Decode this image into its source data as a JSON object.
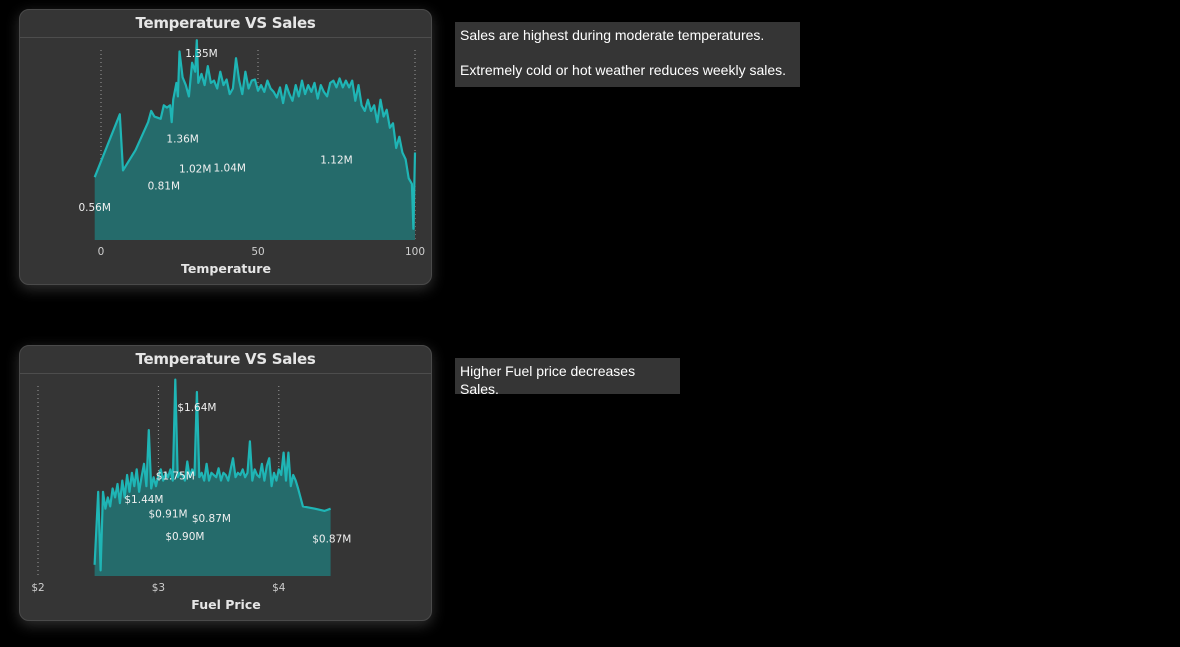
{
  "charts": [
    {
      "title": "Temperature VS Sales",
      "xlabel": "Temperature",
      "x_ticks": [
        "0",
        "50",
        "100"
      ],
      "data_labels": [
        "1.35M",
        "1.36M",
        "1.02M",
        "1.04M",
        "0.81M",
        "0.56M",
        "1.12M"
      ]
    },
    {
      "title": "Temperature VS Sales",
      "xlabel": "Fuel Price",
      "x_ticks": [
        "$2",
        "$3",
        "$4"
      ],
      "data_labels": [
        "$1.64M",
        "$1.75M",
        "$1.44M",
        "$0.91M",
        "$0.87M",
        "$0.90M",
        "$0.87M"
      ]
    }
  ],
  "notes": {
    "note1": [
      "Sales are highest during moderate temperatures.",
      "Extremely cold or hot weather reduces weekly sales."
    ],
    "note2": [
      "Higher Fuel price decreases Sales."
    ]
  },
  "colors": {
    "line": "#1fb5b5",
    "area": "#256b6b",
    "background": "#000000",
    "card": "#353535"
  },
  "chart_data": [
    {
      "type": "area",
      "title": "Temperature VS Sales",
      "xlabel": "Temperature",
      "ylabel": "",
      "xlim": [
        0,
        100
      ],
      "ylim": [
        0,
        1.8
      ],
      "grid": "vertical dotted at x ticks",
      "x_ticks": [
        0,
        50,
        100
      ],
      "x": [
        -2,
        6,
        7,
        11,
        15,
        16,
        17,
        19,
        20,
        21,
        22,
        22.5,
        23,
        24,
        24.5,
        25,
        26,
        27,
        28,
        29,
        30,
        30.5,
        31,
        32,
        33,
        34,
        35,
        36,
        37,
        38,
        39,
        40,
        41,
        42,
        43,
        44,
        45,
        46,
        47,
        48,
        49,
        50,
        51,
        52,
        53,
        54,
        55,
        56,
        57,
        58,
        59,
        60,
        61,
        62,
        63,
        64,
        65,
        66,
        67,
        68,
        69,
        70,
        71,
        72,
        73,
        74,
        75,
        76,
        77,
        78,
        79,
        80,
        81,
        82,
        83,
        84,
        85,
        86,
        87,
        88,
        89,
        90,
        91,
        92,
        93,
        94,
        95,
        96,
        97,
        98,
        99,
        99.5,
        100
      ],
      "series": [
        {
          "name": "",
          "values": [
            0.56,
            1.12,
            0.62,
            0.8,
            1.05,
            1.15,
            1.1,
            1.08,
            1.2,
            1.18,
            1.2,
            1.05,
            1.25,
            1.4,
            1.28,
            1.68,
            1.45,
            1.38,
            1.28,
            1.58,
            1.5,
            1.78,
            1.4,
            1.48,
            1.38,
            1.55,
            1.4,
            1.42,
            1.35,
            1.5,
            1.38,
            1.43,
            1.3,
            1.35,
            1.62,
            1.42,
            1.3,
            1.5,
            1.35,
            1.42,
            1.43,
            1.33,
            1.38,
            1.32,
            1.42,
            1.35,
            1.32,
            1.27,
            1.36,
            1.22,
            1.38,
            1.3,
            1.24,
            1.38,
            1.28,
            1.42,
            1.3,
            1.38,
            1.32,
            1.4,
            1.26,
            1.38,
            1.32,
            1.28,
            1.4,
            1.42,
            1.36,
            1.44,
            1.36,
            1.42,
            1.36,
            1.42,
            1.24,
            1.38,
            1.2,
            1.15,
            1.25,
            1.15,
            1.2,
            1.05,
            1.25,
            1.1,
            1.16,
            1.0,
            1.04,
            0.82,
            0.92,
            0.78,
            0.72,
            0.55,
            0.5,
            0.1,
            0.78,
            0.1
          ]
        }
      ],
      "annotations": [
        {
          "text": "1.35M",
          "x": 32,
          "y": 1.63
        },
        {
          "text": "1.36M",
          "x": 26,
          "y": 0.87
        },
        {
          "text": "1.02M",
          "x": 30,
          "y": 0.6
        },
        {
          "text": "1.04M",
          "x": 41,
          "y": 0.61
        },
        {
          "text": "0.81M",
          "x": 20,
          "y": 0.45
        },
        {
          "text": "0.56M",
          "x": -2,
          "y": 0.26
        },
        {
          "text": "1.12M",
          "x": 75,
          "y": 0.68
        }
      ]
    },
    {
      "type": "area",
      "title": "Temperature VS Sales",
      "xlabel": "Fuel Price",
      "ylabel": "",
      "xlim": [
        2,
        4.5
      ],
      "ylim": [
        0,
        1.8
      ],
      "grid": "vertical dotted at x ticks",
      "x_ticks": [
        2,
        3,
        4
      ],
      "x_tick_labels": [
        "$2",
        "$3",
        "$4"
      ],
      "x": [
        2.47,
        2.5,
        2.52,
        2.54,
        2.56,
        2.58,
        2.6,
        2.62,
        2.64,
        2.66,
        2.68,
        2.7,
        2.72,
        2.74,
        2.76,
        2.78,
        2.8,
        2.82,
        2.84,
        2.86,
        2.88,
        2.9,
        2.92,
        2.94,
        2.96,
        2.98,
        3.0,
        3.02,
        3.04,
        3.06,
        3.08,
        3.1,
        3.12,
        3.14,
        3.16,
        3.18,
        3.2,
        3.22,
        3.24,
        3.26,
        3.28,
        3.3,
        3.32,
        3.34,
        3.36,
        3.38,
        3.4,
        3.42,
        3.44,
        3.46,
        3.48,
        3.5,
        3.52,
        3.54,
        3.56,
        3.58,
        3.6,
        3.62,
        3.64,
        3.66,
        3.68,
        3.7,
        3.72,
        3.74,
        3.76,
        3.78,
        3.8,
        3.82,
        3.84,
        3.86,
        3.88,
        3.9,
        3.92,
        3.94,
        3.96,
        3.98,
        4.0,
        4.02,
        4.04,
        4.06,
        4.08,
        4.1,
        4.12,
        4.14,
        4.16,
        4.2,
        4.3,
        4.38,
        4.43
      ],
      "series": [
        {
          "name": "",
          "values": [
            0.1,
            0.75,
            0.05,
            0.75,
            0.6,
            0.7,
            0.62,
            0.78,
            0.7,
            0.82,
            0.65,
            0.85,
            0.7,
            0.9,
            0.75,
            0.92,
            0.8,
            0.95,
            0.75,
            0.88,
            1.0,
            0.8,
            1.3,
            0.78,
            0.88,
            0.8,
            0.9,
            0.95,
            0.85,
            0.92,
            0.88,
            0.95,
            0.85,
            1.75,
            0.88,
            0.92,
            0.9,
            0.85,
            1.02,
            0.88,
            0.95,
            0.9,
            1.64,
            0.88,
            0.92,
            0.85,
            1.0,
            0.85,
            0.92,
            0.9,
            0.88,
            0.96,
            0.85,
            0.92,
            0.9,
            0.85,
            0.95,
            1.05,
            0.88,
            0.92,
            0.9,
            0.95,
            0.88,
            0.92,
            1.2,
            0.85,
            0.95,
            0.9,
            0.88,
            1.0,
            0.85,
            0.98,
            1.05,
            0.8,
            0.92,
            0.85,
            0.95,
            0.9,
            1.1,
            0.85,
            1.1,
            0.8,
            0.9,
            0.85,
            0.78,
            0.62,
            0.6,
            0.58,
            0.6
          ]
        }
      ],
      "annotations": [
        {
          "text": "$1.64M",
          "x": 3.32,
          "y": 1.47
        },
        {
          "text": "$1.75M",
          "x": 3.14,
          "y": 0.86
        },
        {
          "text": "$1.44M",
          "x": 2.88,
          "y": 0.65
        },
        {
          "text": "$0.91M",
          "x": 3.08,
          "y": 0.52
        },
        {
          "text": "$0.87M",
          "x": 3.44,
          "y": 0.48
        },
        {
          "text": "$0.90M",
          "x": 3.22,
          "y": 0.32
        },
        {
          "text": "$0.87M",
          "x": 4.44,
          "y": 0.3
        }
      ]
    }
  ]
}
